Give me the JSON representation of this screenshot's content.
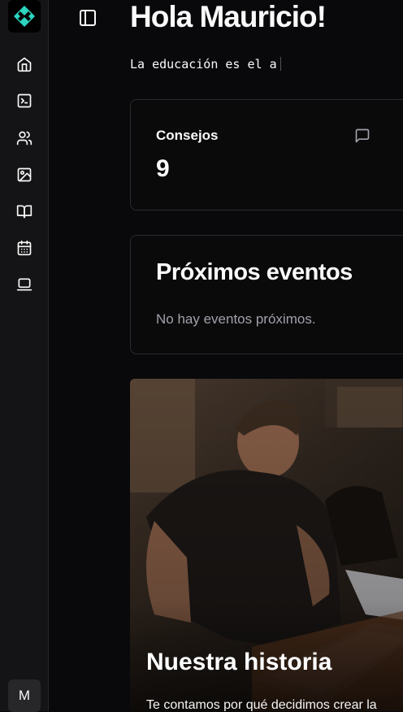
{
  "sidebar": {
    "logo_icon": "app-logo",
    "items": [
      {
        "icon": "home-icon"
      },
      {
        "icon": "terminal-icon"
      },
      {
        "icon": "users-icon"
      },
      {
        "icon": "image-icon"
      },
      {
        "icon": "book-icon"
      },
      {
        "icon": "calendar-icon"
      },
      {
        "icon": "laptop-icon"
      }
    ],
    "avatar_initial": "M"
  },
  "header": {
    "toggle_icon": "sidebar-toggle-icon",
    "greeting": "Hola Mauricio!",
    "typing_text": "La educación es el a"
  },
  "stats": {
    "label": "Consejos",
    "value": "9",
    "icon": "message-square-icon"
  },
  "events": {
    "title": "Próximos eventos",
    "empty_message": "No hay eventos próximos."
  },
  "history": {
    "title": "Nuestra historia",
    "description": "Te contamos por qué decidimos crear la"
  },
  "colors": {
    "background": "#09090b",
    "sidebar": "#141416",
    "border": "#2b2b30",
    "accent": "#2dd4bf",
    "muted_text": "#a1a1aa"
  }
}
